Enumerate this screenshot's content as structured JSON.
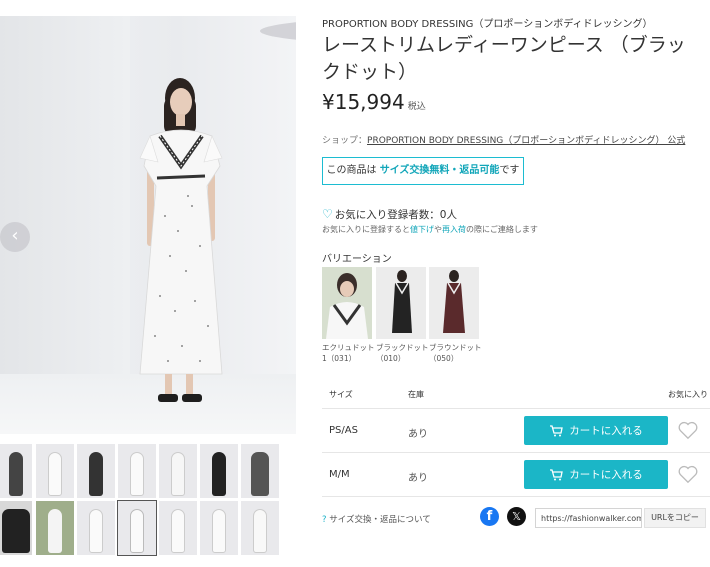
{
  "gallery": {
    "prev_arrow": "‹",
    "next_arrow": "›"
  },
  "product": {
    "brand": "PROPORTION BODY DRESSING（プロポーションボディドレッシング）",
    "title": "レーストリムレディーワンピース （ブラックドット）",
    "price": "¥15,994",
    "tax_label": "税込",
    "shop_prefix": "ショップ：",
    "shop_name": "PROPORTION BODY DRESSING（プロポーションボディドレッシング） 公式",
    "notice_prefix": "この商品は",
    "notice_highlight": "サイズ交換無料・返品可能",
    "notice_suffix": "です",
    "favorite_label": "お気に入り登録者数：",
    "favorite_count": "0人",
    "fav_note_1": "お気に入りに登録すると",
    "fav_note_2": "値下げ",
    "fav_note_3": "や",
    "fav_note_4": "再入荷",
    "fav_note_5": "の際にご連絡します"
  },
  "variations": {
    "label": "バリエーション",
    "items": [
      {
        "caption": "エクリュドット1（031）"
      },
      {
        "caption": "ブラックドット（010）"
      },
      {
        "caption": "ブラウンドット（050）"
      }
    ]
  },
  "stock_table": {
    "headers": {
      "size": "サイズ",
      "stock": "在庫",
      "favorite": "お気に入り"
    },
    "rows": [
      {
        "size": "PS/AS",
        "stock": "あり",
        "cart_label": "カートに入れる"
      },
      {
        "size": "M/M",
        "stock": "あり",
        "cart_label": "カートに入れる"
      }
    ]
  },
  "footer": {
    "exchange_link": "サイズ交換・返品について",
    "facebook_icon_text": "f",
    "x_icon_text": "𝕏",
    "url_value": "https://fashionwalker.com",
    "copy_label": "URLをコピー"
  },
  "colors": {
    "accent": "#1bb6c7",
    "accent_text": "#12a6b9",
    "facebook": "#1877f2"
  }
}
